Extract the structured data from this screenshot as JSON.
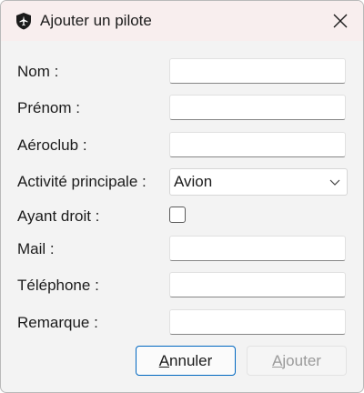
{
  "window": {
    "title": "Ajouter un pilote",
    "icon": "shield-airplane-icon",
    "close_icon": "close-icon"
  },
  "form": {
    "nom_label": "Nom :",
    "prenom_label": "Prénom :",
    "aeroclub_label": "Aéroclub :",
    "activite_label": "Activité principale :",
    "activite_value": "Avion",
    "ayant_droit_label": "Ayant droit :",
    "ayant_droit_checked": false,
    "mail_label": "Mail :",
    "telephone_label": "Téléphone :",
    "remarque_label": "Remarque :",
    "nom_value": "",
    "prenom_value": "",
    "aeroclub_value": "",
    "mail_value": "",
    "telephone_value": "",
    "remarque_value": ""
  },
  "buttons": {
    "cancel_mnemonic": "A",
    "cancel_rest": "nnuler",
    "add_mnemonic": "A",
    "add_rest": "jouter"
  },
  "colors": {
    "accent": "#0067c0",
    "titlebar": "#f8eeee",
    "window_bg": "#f3f3f3"
  }
}
